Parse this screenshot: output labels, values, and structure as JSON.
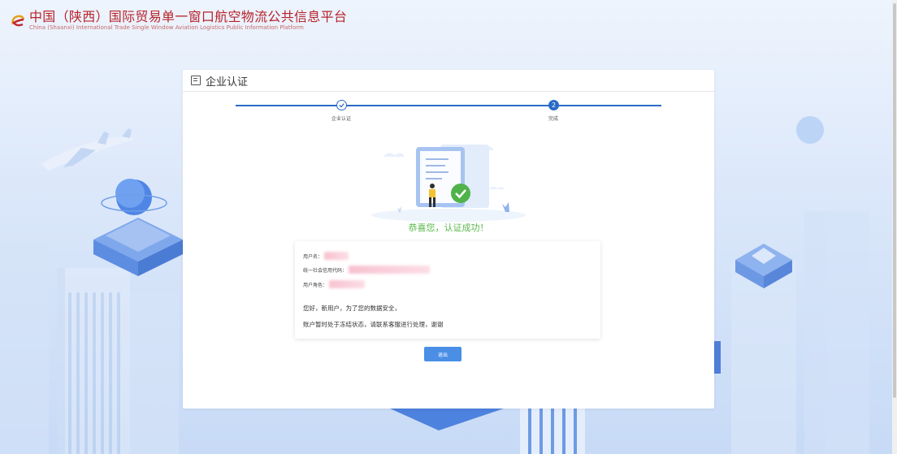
{
  "header": {
    "title": "中国（陕西）国际贸易单一窗口航空物流公共信息平台",
    "subtitle": "China (Shaanxi) International Trade Single Window Aviation Logistics Public Information Platform"
  },
  "card": {
    "title": "企业认证",
    "steps": [
      {
        "label": "企业认证",
        "status": "done"
      },
      {
        "label": "完成",
        "status": "current",
        "number": "2"
      }
    ],
    "success_message": "恭喜您，认证成功！",
    "info": {
      "username_label": "用户名：",
      "credit_code_label": "统一社会信用代码：",
      "role_label": "用户角色：",
      "notice_line1": "您好，新用户，为了您的数据安全，",
      "notice_line2": "账户暂时处于冻结状态，请联系客服进行处理，谢谢"
    },
    "logout_label": "退出"
  },
  "colors": {
    "brand_red": "#b8232b",
    "step_blue": "#2a6bc5",
    "success_green": "#58b84a",
    "button_blue": "#4a8ee6"
  },
  "icons": {
    "logo": "platform-logo-icon",
    "card_header": "document-icon",
    "step_done": "check-icon",
    "success_badge": "check-circle-icon"
  }
}
